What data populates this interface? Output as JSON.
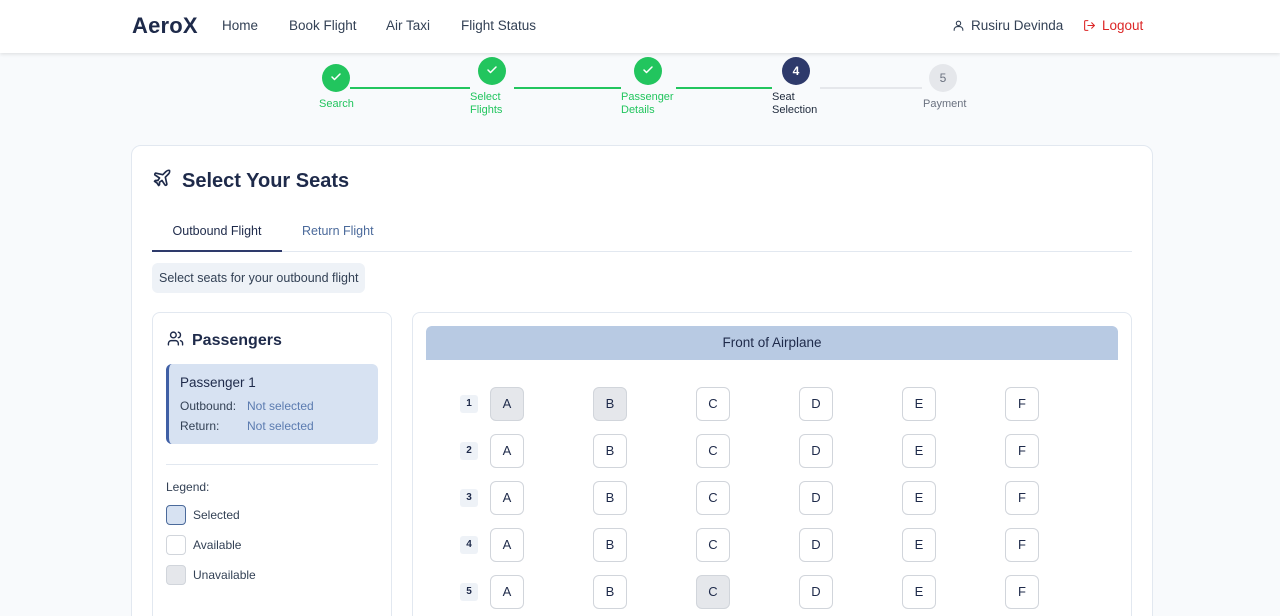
{
  "nav": {
    "brand": "AeroX",
    "links": [
      "Home",
      "Book Flight",
      "Air Taxi",
      "Flight Status"
    ],
    "user_name": "Rusiru Devinda",
    "logout_label": "Logout"
  },
  "steps": [
    {
      "label_line1": "Search",
      "label_line2": "",
      "state": "done",
      "number": "1"
    },
    {
      "label_line1": "Select",
      "label_line2": "Flights",
      "state": "done",
      "number": "2"
    },
    {
      "label_line1": "Passenger",
      "label_line2": "Details",
      "state": "done",
      "number": "3"
    },
    {
      "label_line1": "Seat",
      "label_line2": "Selection",
      "state": "active",
      "number": "4"
    },
    {
      "label_line1": "Payment",
      "label_line2": "",
      "state": "pending",
      "number": "5"
    }
  ],
  "page": {
    "title": "Select Your Seats",
    "tabs": [
      "Outbound Flight",
      "Return Flight"
    ],
    "active_tab": "Outbound Flight",
    "info": "Select seats for your outbound flight"
  },
  "passengers_panel": {
    "title": "Passengers",
    "passenger": {
      "name": "Passenger 1",
      "outbound_label": "Outbound:",
      "outbound_value": "Not selected",
      "return_label": "Return:",
      "return_value": "Not selected"
    },
    "legend_title": "Legend:",
    "legend": [
      "Selected",
      "Available",
      "Unavailable"
    ]
  },
  "seat_map": {
    "front_label": "Front of Airplane",
    "columns": [
      "A",
      "B",
      "C",
      "D",
      "E",
      "F"
    ],
    "rows": [
      {
        "number": "1",
        "seats": [
          "unavailable",
          "unavailable",
          "available",
          "available",
          "available",
          "available"
        ]
      },
      {
        "number": "2",
        "seats": [
          "available",
          "available",
          "available",
          "available",
          "available",
          "available"
        ]
      },
      {
        "number": "3",
        "seats": [
          "available",
          "available",
          "available",
          "available",
          "available",
          "available"
        ]
      },
      {
        "number": "4",
        "seats": [
          "available",
          "available",
          "available",
          "available",
          "available",
          "available"
        ]
      },
      {
        "number": "5",
        "seats": [
          "available",
          "available",
          "unavailable",
          "available",
          "available",
          "available"
        ]
      }
    ]
  },
  "colors": {
    "primary": "#2e3a6b",
    "success": "#22c55e",
    "danger": "#dc2626",
    "selected_seat": "#d7e2f2",
    "banner": "#b8cae3"
  }
}
